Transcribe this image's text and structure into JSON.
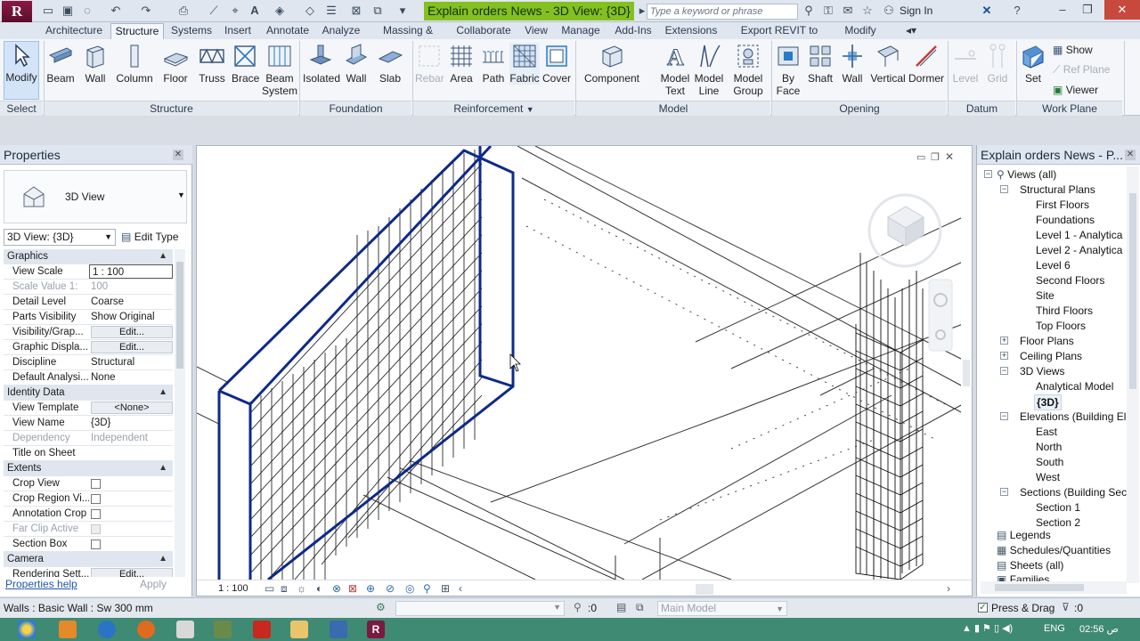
{
  "app": {
    "logo_letter": "R",
    "title": "Explain orders News - 3D View: {3D}",
    "search_placeholder": "Type a keyword or phrase",
    "signin_label": "Sign In",
    "colors": {
      "title_green": "#85c021",
      "close_red": "#c7483c",
      "taskbar": "#3f8a72",
      "selection_blue": "#0d2a8a"
    }
  },
  "ribbon": {
    "tabs": [
      "Architecture",
      "Structure",
      "Systems",
      "Insert",
      "Annotate",
      "Analyze",
      "Massing & Site",
      "Collaborate",
      "View",
      "Manage",
      "Add-Ins",
      "Extensions",
      "Export REVIT to ETABS",
      "Modify"
    ],
    "active_tab": "Structure",
    "panels": {
      "select": "Select",
      "structure": "Structure",
      "foundation": "Foundation",
      "reinforcement": "Reinforcement",
      "model": "Model",
      "opening": "Opening",
      "datum": "Datum",
      "work_plane": "Work Plane"
    },
    "tools": {
      "modify": "Modify",
      "beam": "Beam",
      "wall": "Wall",
      "column": "Column",
      "floor": "Floor",
      "truss": "Truss",
      "brace": "Brace",
      "beam_system_1": "Beam",
      "beam_system_2": "System",
      "isolated": "Isolated",
      "f_wall": "Wall",
      "slab": "Slab",
      "rebar": "Rebar",
      "area": "Area",
      "path": "Path",
      "fabric": "Fabric",
      "cover": "Cover",
      "component": "Component",
      "model_text_1": "Model",
      "model_text_2": "Text",
      "model_line_1": "Model",
      "model_line_2": "Line",
      "model_group_1": "Model",
      "model_group_2": "Group",
      "by_face_1": "By",
      "by_face_2": "Face",
      "shaft": "Shaft",
      "o_wall": "Wall",
      "vertical": "Vertical",
      "dormer": "Dormer",
      "level": "Level",
      "grid": "Grid",
      "set": "Set",
      "show": "Show",
      "ref_plane": "Ref Plane",
      "viewer": "Viewer"
    }
  },
  "properties": {
    "title": "Properties",
    "type_name": "3D View",
    "view_selector": "3D View: {3D}",
    "edit_type": "Edit Type",
    "groups": {
      "graphics": "Graphics",
      "identity": "Identity Data",
      "extents": "Extents",
      "camera": "Camera"
    },
    "rows": {
      "view_scale_k": "View Scale",
      "view_scale_v": "1 : 100",
      "scale_value_k": "Scale Value    1:",
      "scale_value_v": "100",
      "detail_level_k": "Detail Level",
      "detail_level_v": "Coarse",
      "parts_vis_k": "Parts Visibility",
      "parts_vis_v": "Show Original",
      "vis_graphics_k": "Visibility/Grap...",
      "vis_graphics_v": "Edit...",
      "graphic_disp_k": "Graphic Displa...",
      "graphic_disp_v": "Edit...",
      "discipline_k": "Discipline",
      "discipline_v": "Structural",
      "default_analysis_k": "Default Analysi...",
      "default_analysis_v": "None",
      "view_template_k": "View Template",
      "view_template_v": "<None>",
      "view_name_k": "View Name",
      "view_name_v": "{3D}",
      "dependency_k": "Dependency",
      "dependency_v": "Independent",
      "title_sheet_k": "Title on Sheet",
      "title_sheet_v": "",
      "crop_view_k": "Crop View",
      "crop_region_k": "Crop Region Vi...",
      "annotation_crop_k": "Annotation Crop",
      "far_clip_k": "Far Clip Active",
      "section_box_k": "Section Box",
      "rendering_k": "Rendering Sett...",
      "rendering_v": "Edit..."
    },
    "help_link": "Properties help",
    "apply": "Apply"
  },
  "viewport": {
    "scale": "1 : 100"
  },
  "browser": {
    "title": "Explain orders News - P...",
    "items": {
      "views_all": "Views (all)",
      "structural_plans": "Structural Plans",
      "first_floors": "First Floors",
      "foundations": "Foundations",
      "level1": "Level 1 - Analytica",
      "level2": "Level 2 - Analytica",
      "level6": "Level 6",
      "second_floors": "Second Floors",
      "site": "Site",
      "third_floors": "Third Floors",
      "top_floors": "Top Floors",
      "floor_plans": "Floor Plans",
      "ceiling_plans": "Ceiling Plans",
      "views_3d": "3D Views",
      "analytical_model": "Analytical Model",
      "view_3d": "{3D}",
      "elevations": "Elevations (Building Ele",
      "east": "East",
      "north": "North",
      "south": "South",
      "west": "West",
      "sections": "Sections (Building Secti",
      "section1": "Section 1",
      "section2": "Section 2",
      "legends": "Legends",
      "schedules": "Schedules/Quantities",
      "sheets": "Sheets (all)",
      "families": "Families"
    }
  },
  "status": {
    "message": "Walls : Basic Wall : Sw 300 mm",
    "workset_count": ":0",
    "design_option": "Main Model",
    "press_drag": "Press & Drag",
    "filter_count": ":0"
  },
  "taskbar": {
    "lang": "ENG",
    "time": "02:56 ص"
  }
}
